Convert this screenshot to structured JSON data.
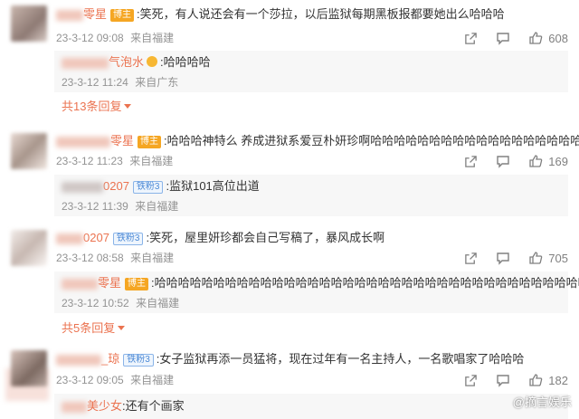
{
  "comments": [
    {
      "user": "零星",
      "badge": "博主",
      "text": ":笑死，有人说还会有一个莎拉，以后监狱每期黑板报都要她出么哈哈哈",
      "time": "23-3-12 09:08",
      "location": "来自福建",
      "likes": "608",
      "reply": {
        "user": "气泡水",
        "text": ":哈哈哈哈",
        "time": "23-3-12 11:24",
        "location": "来自广东"
      },
      "more": "共13条回复"
    },
    {
      "user": "零星",
      "badge": "博主",
      "text": ":哈哈哈神特么 养成进狱系爱豆朴妍珍啊哈哈哈哈哈哈哈哈哈哈哈哈哈哈哈哈哈哈",
      "time": "23-3-12 11:23",
      "location": "来自福建",
      "likes": "169",
      "reply": {
        "user": "0207",
        "fan_badge": "铁粉3",
        "text": ":监狱101高位出道",
        "time": "23-3-12 11:39",
        "location": "来自福建"
      }
    },
    {
      "user": "0207",
      "fan_badge": "铁粉3",
      "text": ":笑死，屋里妍珍都会自己写稿了，暴风成长啊",
      "time": "23-3-12 08:58",
      "location": "来自福建",
      "likes": "705",
      "reply": {
        "user": "零星",
        "badge": "博主",
        "text": ":哈哈哈哈哈哈哈哈哈哈哈哈哈哈哈哈哈哈哈哈哈哈哈哈哈哈哈哈哈哈哈哈哈哈哈哈哈",
        "time": "23-3-12 10:52",
        "location": "来自福建"
      },
      "more": "共5条回复"
    },
    {
      "user": "_琼",
      "fan_badge": "铁粉3",
      "text": ":女子监狱再添一员猛将，现在过年有一名主持人，一名歌唱家了哈哈哈",
      "time": "23-3-12 09:05",
      "location": "来自福建",
      "likes": "182",
      "reply": {
        "user": "美少女",
        "text": ":还有个画家"
      }
    }
  ],
  "watermark": "@摘言娱乐",
  "colors": {
    "accent": "#eb7350",
    "meta": "#939393",
    "host_badge": "#f5a623",
    "fan_badge": "#4d8ad6"
  }
}
